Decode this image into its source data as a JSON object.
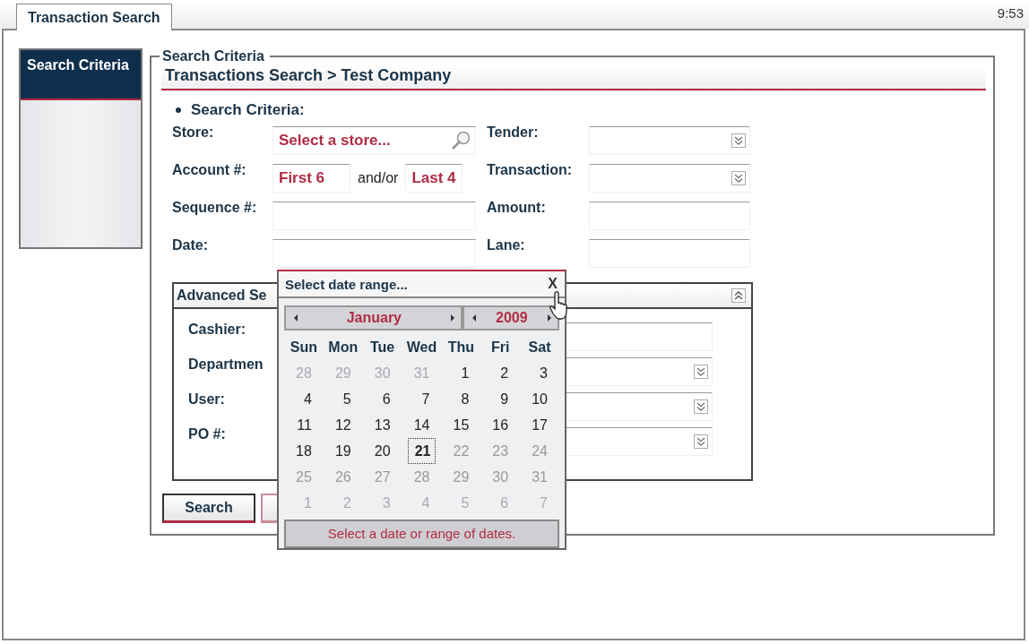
{
  "window": {
    "tab": {
      "label": "Transaction Search",
      "selected": true
    },
    "clock": "9:53"
  },
  "sidebar": {
    "items": [
      {
        "label": "Search Criteria",
        "selected": true
      }
    ]
  },
  "search_panel": {
    "legend": "Search Criteria",
    "heading": "Transactions Search > Test Company",
    "section": "Search Criteria:",
    "fields": [
      {
        "label": "Store:",
        "kind": "lookup",
        "placeholder": "Select a store..."
      },
      {
        "label": "Tender:",
        "kind": "dropdown"
      },
      {
        "label": "Account #:",
        "kind": "split",
        "placeholder": "First 6",
        "joiner": "and/or",
        "placeholder_2": "Last 4"
      },
      {
        "label": "Transaction:",
        "kind": "dropdown"
      },
      {
        "label": "Sequence #:",
        "kind": "text"
      },
      {
        "label": "Amount:",
        "kind": "text"
      },
      {
        "label": "Date:",
        "kind": "text"
      },
      {
        "label": "Lane:",
        "kind": "text"
      }
    ]
  },
  "advanced": {
    "title": "Advanced Se",
    "expanded": true,
    "fields": [
      {
        "label": "Cashier:",
        "kind": "text"
      },
      {
        "label": "Departmen",
        "kind": "dropdown"
      },
      {
        "label": "User:",
        "kind": "dropdown"
      },
      {
        "label": "PO #:",
        "kind": "dropdown"
      }
    ]
  },
  "buttons": [
    "Search"
  ],
  "date_picker": {
    "title": "Select date range...",
    "close": "X",
    "month": "January",
    "year": "2009",
    "weekdays": [
      "Sun",
      "Mon",
      "Tue",
      "Wed",
      "Thu",
      "Fri",
      "Sat"
    ],
    "days": [
      {
        "label": "28",
        "kind": "outside",
        "selected": false
      },
      {
        "label": "29",
        "kind": "outside",
        "selected": false
      },
      {
        "label": "30",
        "kind": "outside",
        "selected": false
      },
      {
        "label": "31",
        "kind": "outside",
        "selected": false
      },
      {
        "label": "1",
        "kind": "normal",
        "selected": false
      },
      {
        "label": "2",
        "kind": "normal",
        "selected": false
      },
      {
        "label": "3",
        "kind": "normal",
        "selected": false
      },
      {
        "label": "4",
        "kind": "normal",
        "selected": false
      },
      {
        "label": "5",
        "kind": "normal",
        "selected": false
      },
      {
        "label": "6",
        "kind": "normal",
        "selected": false
      },
      {
        "label": "7",
        "kind": "normal",
        "selected": false
      },
      {
        "label": "8",
        "kind": "normal",
        "selected": false
      },
      {
        "label": "9",
        "kind": "normal",
        "selected": false
      },
      {
        "label": "10",
        "kind": "normal",
        "selected": false
      },
      {
        "label": "11",
        "kind": "normal",
        "selected": false
      },
      {
        "label": "12",
        "kind": "normal",
        "selected": false
      },
      {
        "label": "13",
        "kind": "normal",
        "selected": false
      },
      {
        "label": "14",
        "kind": "normal",
        "selected": false
      },
      {
        "label": "15",
        "kind": "normal",
        "selected": false
      },
      {
        "label": "16",
        "kind": "normal",
        "selected": false
      },
      {
        "label": "17",
        "kind": "normal",
        "selected": false
      },
      {
        "label": "18",
        "kind": "normal",
        "selected": false
      },
      {
        "label": "19",
        "kind": "normal",
        "selected": false
      },
      {
        "label": "20",
        "kind": "normal",
        "selected": false
      },
      {
        "label": "21",
        "kind": "normal",
        "selected": true
      },
      {
        "label": "22",
        "kind": "disabled",
        "selected": false
      },
      {
        "label": "23",
        "kind": "disabled",
        "selected": false
      },
      {
        "label": "24",
        "kind": "disabled",
        "selected": false
      },
      {
        "label": "25",
        "kind": "disabled",
        "selected": false
      },
      {
        "label": "26",
        "kind": "disabled",
        "selected": false
      },
      {
        "label": "27",
        "kind": "disabled",
        "selected": false
      },
      {
        "label": "28",
        "kind": "disabled",
        "selected": false
      },
      {
        "label": "29",
        "kind": "disabled",
        "selected": false
      },
      {
        "label": "30",
        "kind": "disabled",
        "selected": false
      },
      {
        "label": "31",
        "kind": "disabled",
        "selected": false
      },
      {
        "label": "1",
        "kind": "outside",
        "selected": false
      },
      {
        "label": "2",
        "kind": "outside",
        "selected": false
      },
      {
        "label": "3",
        "kind": "outside",
        "selected": false
      },
      {
        "label": "4",
        "kind": "outside",
        "selected": false
      },
      {
        "label": "5",
        "kind": "outside",
        "selected": false
      },
      {
        "label": "6",
        "kind": "outside",
        "selected": false
      },
      {
        "label": "7",
        "kind": "outside",
        "selected": false
      }
    ],
    "hint": "Select a date or range of dates."
  }
}
